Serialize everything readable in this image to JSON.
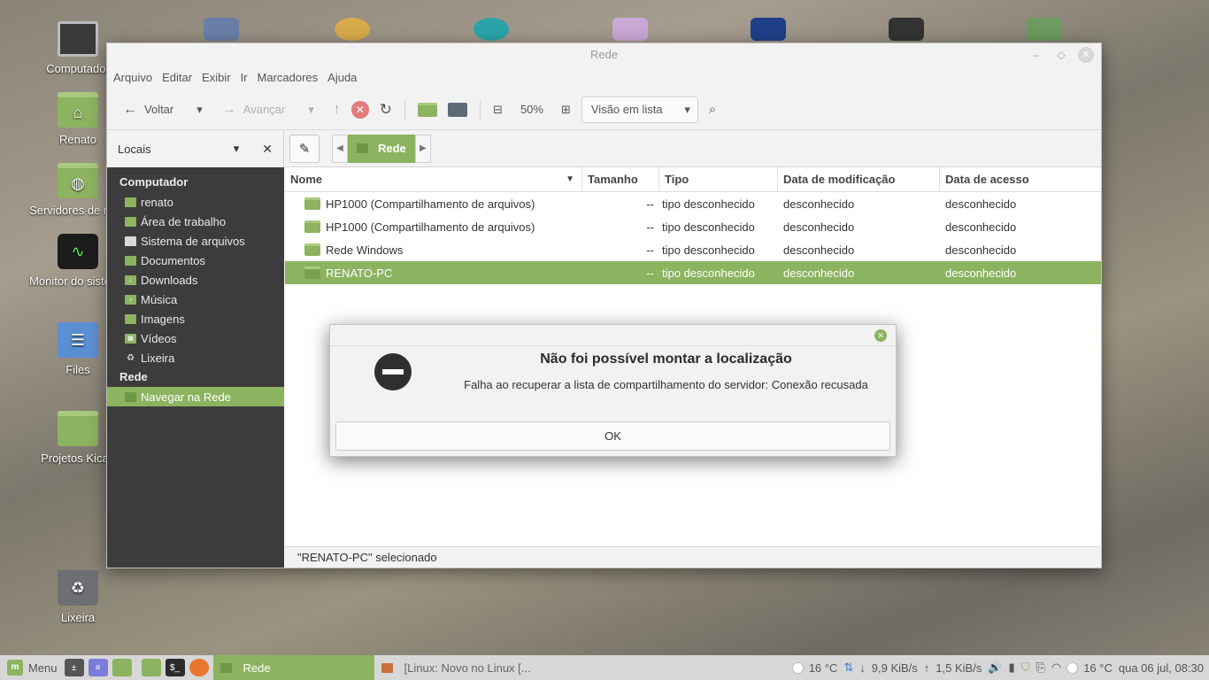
{
  "desktop": {
    "icons": [
      {
        "label": "Computador",
        "icon": "monitor-icon"
      },
      {
        "label": "Renato",
        "icon": "home-folder-icon"
      },
      {
        "label": "Servidores de rede",
        "icon": "network-folder-icon"
      },
      {
        "label": "Monitor do sistema",
        "icon": "system-monitor-icon"
      },
      {
        "label": "Files",
        "icon": "file-cabinet-icon"
      },
      {
        "label": "Projetos Kicad",
        "icon": "folder-icon"
      },
      {
        "label": "Lixeira",
        "icon": "trash-icon"
      }
    ]
  },
  "window": {
    "title": "Rede",
    "menu": [
      "Arquivo",
      "Editar",
      "Exibir",
      "Ir",
      "Marcadores",
      "Ajuda"
    ],
    "toolbar": {
      "back": "Voltar",
      "forward": "Avançar",
      "zoom": "50%",
      "view_mode": "Visão em lista"
    },
    "sidebar": {
      "header": "Locais",
      "sections": [
        {
          "title": "Computador",
          "items": [
            "renato",
            "Área de trabalho",
            "Sistema de arquivos",
            "Documentos",
            "Downloads",
            "Música",
            "Imagens",
            "Vídeos",
            "Lixeira"
          ]
        },
        {
          "title": "Rede",
          "items": [
            "Navegar na Rede"
          ]
        }
      ]
    },
    "pathbar": {
      "crumb": "Rede"
    },
    "columns": [
      "Nome",
      "Tamanho",
      "Tipo",
      "Data de modificação",
      "Data de acesso"
    ],
    "rows": [
      {
        "name": "HP1000 (Compartilhamento de arquivos)",
        "size": "--",
        "type": "tipo desconhecido",
        "modified": "desconhecido",
        "accessed": "desconhecido"
      },
      {
        "name": "HP1000 (Compartilhamento de arquivos)",
        "size": "--",
        "type": "tipo desconhecido",
        "modified": "desconhecido",
        "accessed": "desconhecido"
      },
      {
        "name": "Rede Windows",
        "size": "--",
        "type": "tipo desconhecido",
        "modified": "desconhecido",
        "accessed": "desconhecido"
      },
      {
        "name": "RENATO-PC",
        "size": "--",
        "type": "tipo desconhecido",
        "modified": "desconhecido",
        "accessed": "desconhecido"
      }
    ],
    "status": "\"RENATO-PC\" selecionado"
  },
  "dialog": {
    "title": "Não foi possível montar a localização",
    "message": "Falha ao recuperar a lista de compartilhamento do servidor: Conexão recusada",
    "ok": "OK"
  },
  "taskbar": {
    "menu": "Menu",
    "tasks": [
      {
        "label": "Rede",
        "active": true
      },
      {
        "label": "[Linux: Novo no Linux [...",
        "active": false
      }
    ],
    "weather_left": "16 °C",
    "net_down": "9,9 KiB/s",
    "net_up": "1,5 KiB/s",
    "weather_right": "16 °C",
    "clock": "qua 06 jul, 08:30"
  },
  "colors": {
    "accent": "#8cb35f",
    "sidebar_bg": "#3c3c3c",
    "stop": "#e47b7b"
  }
}
